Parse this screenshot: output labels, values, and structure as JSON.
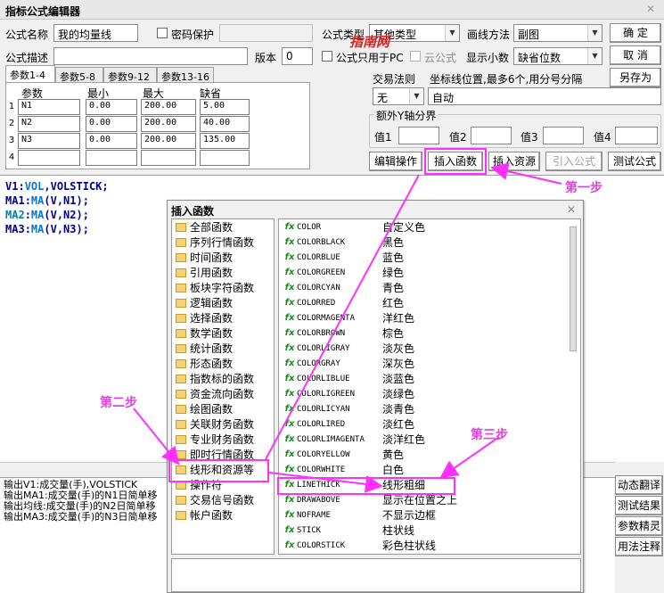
{
  "window": {
    "title": "指标公式编辑器"
  },
  "form": {
    "name_label": "公式名称",
    "name_value": "我的均量线",
    "password_label": "密码保护",
    "type_label": "公式类型",
    "type_value": "其他类型",
    "draw_label": "画线方法",
    "draw_value": "副图",
    "desc_label": "公式描述",
    "version_label": "版本",
    "version_value": "0",
    "pc_only_label": "公式只用于PC",
    "cloud_label": "云公式",
    "decimals_label": "显示小数",
    "decimals_value": "缺省位数"
  },
  "buttons": {
    "ok": "确  定",
    "cancel": "取  消",
    "save_as": "另存为",
    "edit_ops": "编辑操作",
    "insert_func": "插入函数",
    "insert_res": "插入资源",
    "import": "引入公式",
    "test": "测试公式",
    "dyn_translate": "动态翻译",
    "test_result": "测试结果",
    "param_wizard": "参数精灵",
    "usage_notes": "用法注释"
  },
  "watermark": "指南网",
  "tabs": [
    "参数1-4",
    "参数5-8",
    "参数9-12",
    "参数13-16"
  ],
  "params": {
    "headers": [
      "参数",
      "最小",
      "最大",
      "缺省"
    ],
    "rows": [
      {
        "n": "1",
        "name": "N1",
        "min": "0.00",
        "max": "200.00",
        "def": "5.00"
      },
      {
        "n": "2",
        "name": "N2",
        "min": "0.00",
        "max": "200.00",
        "def": "40.00"
      },
      {
        "n": "3",
        "name": "N3",
        "min": "0.00",
        "max": "200.00",
        "def": "135.00"
      },
      {
        "n": "4",
        "name": "",
        "min": "",
        "max": "",
        "def": ""
      }
    ]
  },
  "trade": {
    "rule_label": "交易法则",
    "coord_label": "坐标线位置,最多6个,用分号分隔",
    "rule_value": "无",
    "coord_value": "自动",
    "extra_y_label": "额外Y轴分界",
    "v1": "值1",
    "v2": "值2",
    "v3": "值3",
    "v4": "值4"
  },
  "code_lines": [
    [
      {
        "t": "V1",
        "c": "navy"
      },
      {
        "t": ":",
        "c": "navy"
      },
      {
        "t": "VOL",
        "c": "blue"
      },
      {
        "t": ",",
        "c": "navy"
      },
      {
        "t": "VOLSTICK",
        "c": "navy"
      },
      {
        "t": ";",
        "c": "navy"
      }
    ],
    [
      {
        "t": "MA1",
        "c": "navy"
      },
      {
        "t": ":",
        "c": "navy"
      },
      {
        "t": "MA",
        "c": "blue"
      },
      {
        "t": "(V,N1);",
        "c": "navy"
      }
    ],
    [
      {
        "t": "MA2",
        "c": "teal"
      },
      {
        "t": ":",
        "c": "navy"
      },
      {
        "t": "MA",
        "c": "blue"
      },
      {
        "t": "(V,N2);",
        "c": "navy"
      }
    ],
    [
      {
        "t": "MA3",
        "c": "navy"
      },
      {
        "t": ":",
        "c": "navy"
      },
      {
        "t": "MA",
        "c": "blue"
      },
      {
        "t": "(V,N3);",
        "c": "navy"
      }
    ]
  ],
  "output": [
    "输出V1:成交量(手),VOLSTICK",
    "输出MA1:成交量(手)的N1日简单移",
    "输出均线:成交量(手)的N2日简单移",
    "输出MA3:成交量(手)的N3日简单移"
  ],
  "dialog": {
    "title": "插入函数",
    "categories": [
      "全部函数",
      "序列行情函数",
      "时间函数",
      "引用函数",
      "板块字符函数",
      "逻辑函数",
      "选择函数",
      "数学函数",
      "统计函数",
      "形态函数",
      "指数标的函数",
      "资金流向函数",
      "绘图函数",
      "关联财务函数",
      "专业财务函数",
      "即时行情函数",
      "线形和资源等",
      "操作符",
      "交易信号函数",
      "帐户函数"
    ],
    "functions": [
      {
        "name": "COLOR",
        "desc": "自定义色"
      },
      {
        "name": "COLORBLACK",
        "desc": "黑色"
      },
      {
        "name": "COLORBLUE",
        "desc": "蓝色"
      },
      {
        "name": "COLORGREEN",
        "desc": "绿色"
      },
      {
        "name": "COLORCYAN",
        "desc": "青色"
      },
      {
        "name": "COLORRED",
        "desc": "红色"
      },
      {
        "name": "COLORMAGENTA",
        "desc": "洋红色"
      },
      {
        "name": "COLORBROWN",
        "desc": "棕色"
      },
      {
        "name": "COLORLIGRAY",
        "desc": "淡灰色"
      },
      {
        "name": "COLORGRAY",
        "desc": "深灰色"
      },
      {
        "name": "COLORLIBLUE",
        "desc": "淡蓝色"
      },
      {
        "name": "COLORLIGREEN",
        "desc": "淡绿色"
      },
      {
        "name": "COLORLICYAN",
        "desc": "淡青色"
      },
      {
        "name": "COLORLIRED",
        "desc": "淡红色"
      },
      {
        "name": "COLORLIMAGENTA",
        "desc": "淡洋红色"
      },
      {
        "name": "COLORYELLOW",
        "desc": "黄色"
      },
      {
        "name": "COLORWHITE",
        "desc": "白色"
      },
      {
        "name": "LINETHICK",
        "desc": "线形粗细"
      },
      {
        "name": "DRAWABOVE",
        "desc": "显示在位置之上"
      },
      {
        "name": "NOFRAME",
        "desc": "不显示边框"
      },
      {
        "name": "STICK",
        "desc": "柱状线"
      },
      {
        "name": "COLORSTICK",
        "desc": "彩色柱状线"
      }
    ]
  },
  "annotations": {
    "step1": "第一步",
    "step2": "第二步",
    "step3": "第三步"
  },
  "colors": {
    "annotation": "#ff30ff",
    "fx": "#1a8a1a"
  }
}
